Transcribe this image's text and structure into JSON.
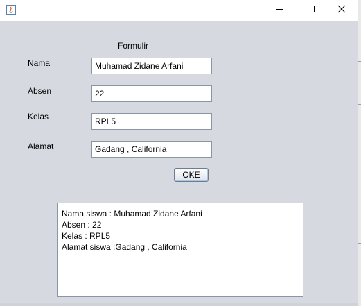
{
  "window": {
    "title_icon": "java-app-icon",
    "controls": {
      "minimize": "minimize-icon",
      "maximize": "maximize-icon",
      "close": "close-icon"
    }
  },
  "form": {
    "title": "Formulir",
    "nama_label": "Nama",
    "nama_value": "Muhamad Zidane Arfani",
    "absen_label": "Absen",
    "absen_value": "22",
    "kelas_label": "Kelas",
    "kelas_value": "RPL5",
    "alamat_label": "Alamat",
    "alamat_value": "Gadang , California",
    "ok_label": "OKE"
  },
  "output": {
    "lines": [
      "Nama siswa : Muhamad Zidane Arfani",
      "Absen : 22",
      "Kelas : RPL5",
      "Alamat siswa :Gadang , California"
    ]
  }
}
